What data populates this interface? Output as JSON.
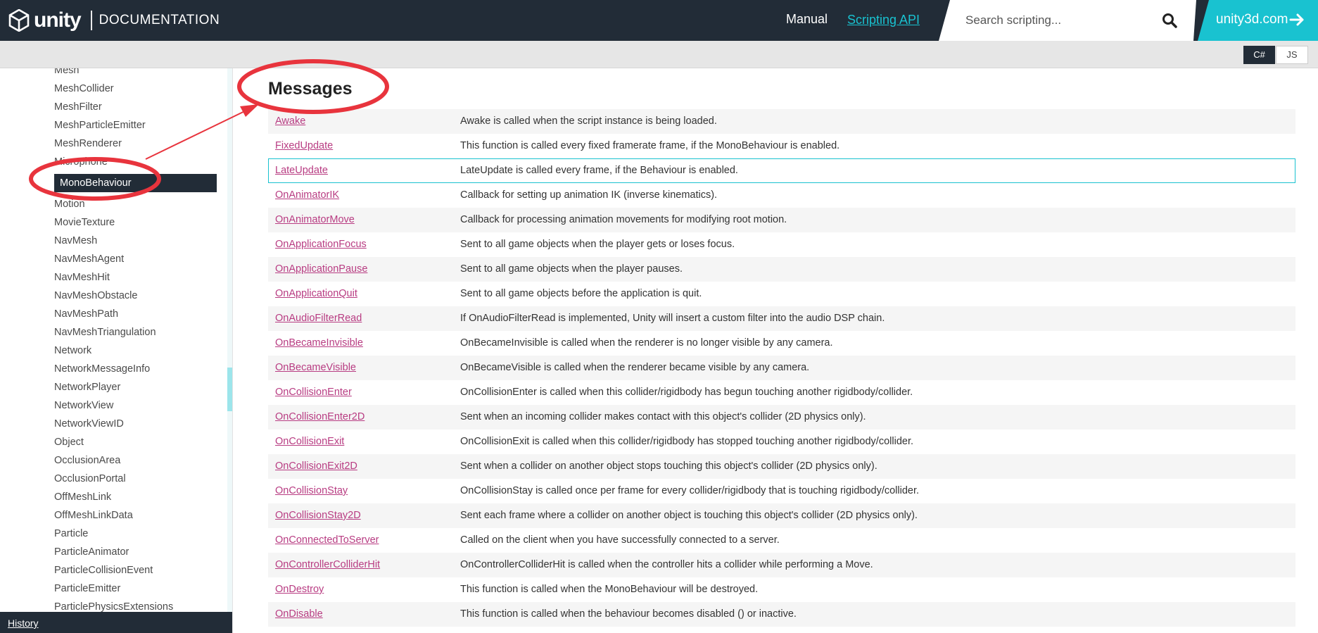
{
  "header": {
    "logo_word": "unity",
    "section": "DOCUMENTATION",
    "nav_manual": "Manual",
    "nav_scripting": "Scripting API",
    "search_placeholder": "Search scripting...",
    "site_link": "unity3d.com"
  },
  "language": {
    "cs": "C#",
    "js": "JS",
    "selected": "C#"
  },
  "sidebar": {
    "items": [
      "Mesh",
      "MeshCollider",
      "MeshFilter",
      "MeshParticleEmitter",
      "MeshRenderer",
      "Microphone",
      "MonoBehaviour",
      "Motion",
      "MovieTexture",
      "NavMesh",
      "NavMeshAgent",
      "NavMeshHit",
      "NavMeshObstacle",
      "NavMeshPath",
      "NavMeshTriangulation",
      "Network",
      "NetworkMessageInfo",
      "NetworkPlayer",
      "NetworkView",
      "NetworkViewID",
      "Object",
      "OcclusionArea",
      "OcclusionPortal",
      "OffMeshLink",
      "OffMeshLinkData",
      "Particle",
      "ParticleAnimator",
      "ParticleCollisionEvent",
      "ParticleEmitter",
      "ParticlePhysicsExtensions"
    ],
    "active": "MonoBehaviour",
    "history_label": "History"
  },
  "main": {
    "title": "Messages",
    "rows": [
      {
        "name": "Awake",
        "desc": "Awake is called when the script instance is being loaded."
      },
      {
        "name": "FixedUpdate",
        "desc": "This function is called every fixed framerate frame, if the MonoBehaviour is enabled."
      },
      {
        "name": "LateUpdate",
        "desc": "LateUpdate is called every frame, if the Behaviour is enabled."
      },
      {
        "name": "OnAnimatorIK",
        "desc": "Callback for setting up animation IK (inverse kinematics)."
      },
      {
        "name": "OnAnimatorMove",
        "desc": "Callback for processing animation movements for modifying root motion."
      },
      {
        "name": "OnApplicationFocus",
        "desc": "Sent to all game objects when the player gets or loses focus."
      },
      {
        "name": "OnApplicationPause",
        "desc": "Sent to all game objects when the player pauses."
      },
      {
        "name": "OnApplicationQuit",
        "desc": "Sent to all game objects before the application is quit."
      },
      {
        "name": "OnAudioFilterRead",
        "desc": "If OnAudioFilterRead is implemented, Unity will insert a custom filter into the audio DSP chain."
      },
      {
        "name": "OnBecameInvisible",
        "desc": "OnBecameInvisible is called when the renderer is no longer visible by any camera."
      },
      {
        "name": "OnBecameVisible",
        "desc": "OnBecameVisible is called when the renderer became visible by any camera."
      },
      {
        "name": "OnCollisionEnter",
        "desc": "OnCollisionEnter is called when this collider/rigidbody has begun touching another rigidbody/collider."
      },
      {
        "name": "OnCollisionEnter2D",
        "desc": "Sent when an incoming collider makes contact with this object's collider (2D physics only)."
      },
      {
        "name": "OnCollisionExit",
        "desc": "OnCollisionExit is called when this collider/rigidbody has stopped touching another rigidbody/collider."
      },
      {
        "name": "OnCollisionExit2D",
        "desc": "Sent when a collider on another object stops touching this object's collider (2D physics only)."
      },
      {
        "name": "OnCollisionStay",
        "desc": "OnCollisionStay is called once per frame for every collider/rigidbody that is touching rigidbody/collider."
      },
      {
        "name": "OnCollisionStay2D",
        "desc": "Sent each frame where a collider on another object is touching this object's collider (2D physics only)."
      },
      {
        "name": "OnConnectedToServer",
        "desc": "Called on the client when you have successfully connected to a server."
      },
      {
        "name": "OnControllerColliderHit",
        "desc": "OnControllerColliderHit is called when the controller hits a collider while performing a Move."
      },
      {
        "name": "OnDestroy",
        "desc": "This function is called when the MonoBehaviour will be destroyed."
      },
      {
        "name": "OnDisable",
        "desc": "This function is called when the behaviour becomes disabled () or inactive."
      }
    ],
    "highlighted_row": "LateUpdate"
  },
  "colors": {
    "header_bg": "#222c37",
    "accent": "#19c2d0",
    "link": "#b83c82",
    "annotation": "#e8343d"
  }
}
